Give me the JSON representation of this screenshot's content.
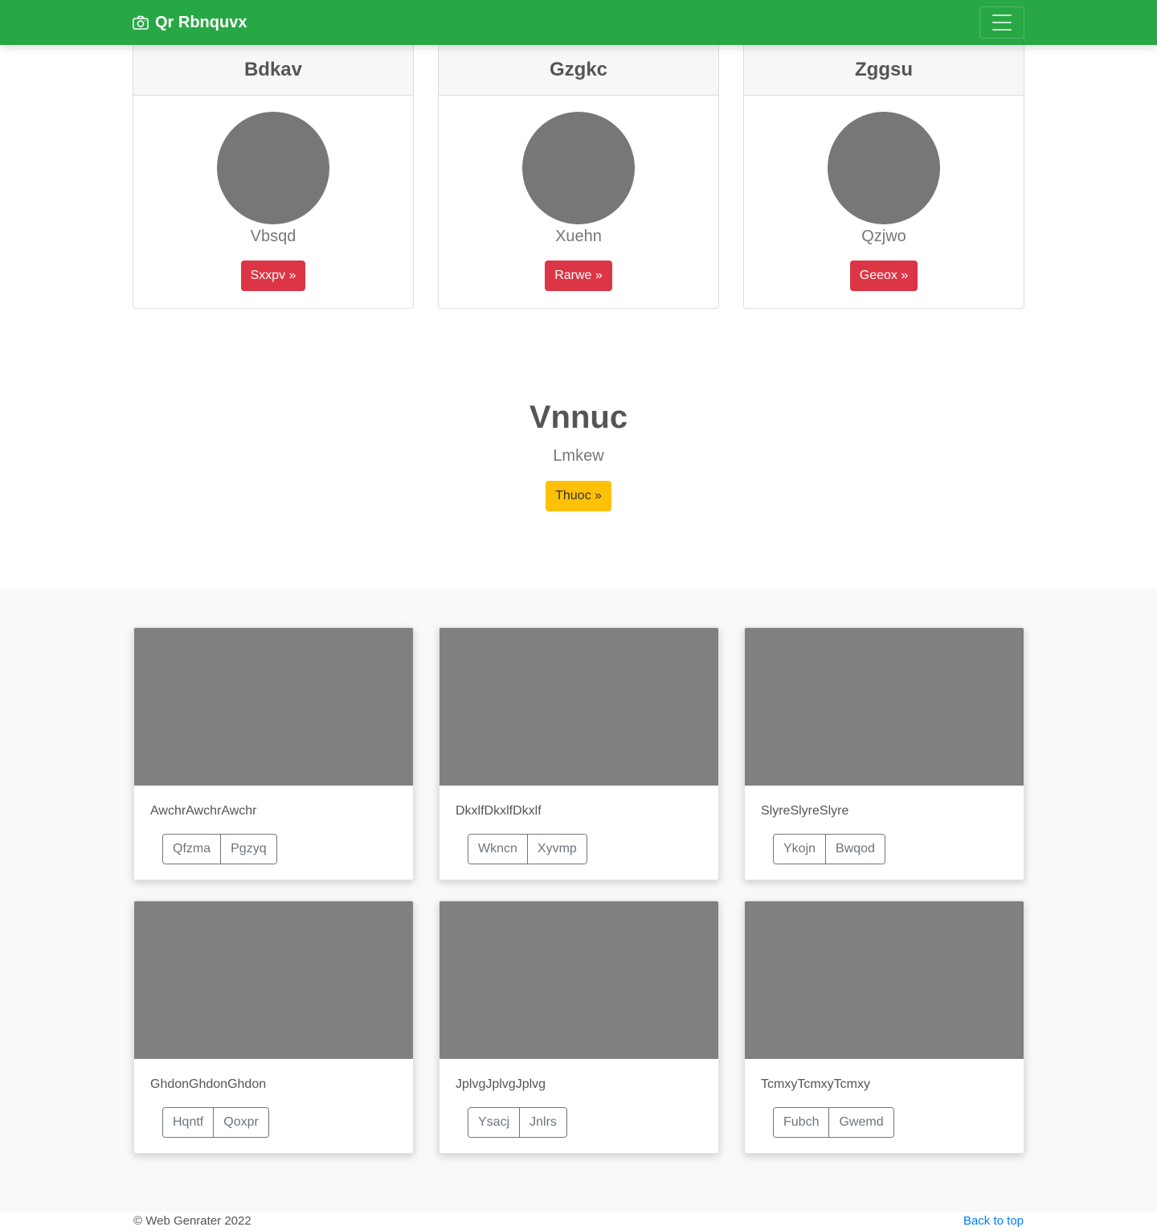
{
  "navbar": {
    "brand_text": "Qr Rbnquvx",
    "brand_icon": "camera-icon",
    "toggler_icon": "hamburger-icon",
    "color": "#28a745"
  },
  "profiles": [
    {
      "title": "Bdkav",
      "subtitle": "Vbsqd",
      "button": "Sxxpv »"
    },
    {
      "title": "Gzgkc",
      "subtitle": "Xuehn",
      "button": "Rarwe »"
    },
    {
      "title": "Zggsu",
      "subtitle": "Qzjwo",
      "button": "Geeox »"
    }
  ],
  "hero": {
    "title": "Vnnuc",
    "subtitle": "Lmkew",
    "button": "Thuoc »"
  },
  "album": [
    {
      "text": "AwchrAwchrAwchr",
      "buttons": [
        "Qfzma",
        "Pgzyq"
      ]
    },
    {
      "text": "DkxlfDkxlfDkxlf",
      "buttons": [
        "Wkncn",
        "Xyvmp"
      ]
    },
    {
      "text": "SlyreSlyreSlyre",
      "buttons": [
        "Ykojn",
        "Bwqod"
      ]
    },
    {
      "text": "GhdonGhdonGhdon",
      "buttons": [
        "Hqntf",
        "Qoxpr"
      ]
    },
    {
      "text": "JplvgJplvgJplvg",
      "buttons": [
        "Ysacj",
        "Jnlrs"
      ]
    },
    {
      "text": "TcmxyTcmxyTcmxy",
      "buttons": [
        "Fubch",
        "Gwemd"
      ]
    }
  ],
  "footer": {
    "copyright": "© Web Genrater 2022",
    "back_to_top": "Back to top"
  },
  "colors": {
    "primary_green": "#28a745",
    "danger_red": "#dc3545",
    "warning_yellow": "#ffc107",
    "link_blue": "#007bff"
  }
}
